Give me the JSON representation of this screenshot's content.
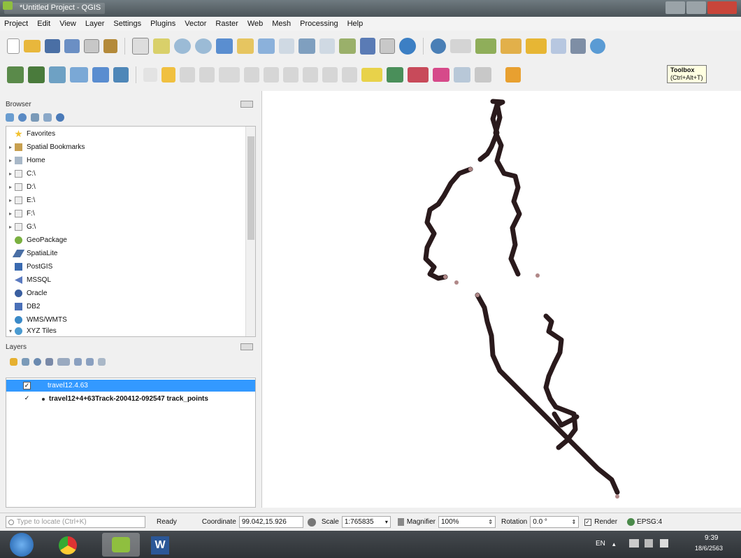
{
  "window": {
    "title": "*Untitled Project - QGIS"
  },
  "menu": [
    "Project",
    "Edit",
    "View",
    "Layer",
    "Settings",
    "Plugins",
    "Vector",
    "Raster",
    "Web",
    "Mesh",
    "Processing",
    "Help"
  ],
  "toolbar": {
    "tooltip_title": "Toolbox",
    "tooltip_shortcut": "(Ctrl+Alt+T)"
  },
  "browser": {
    "title": "Browser",
    "items": [
      {
        "label": "Favorites",
        "icon": "star-icon",
        "expandable": false
      },
      {
        "label": "Spatial Bookmarks",
        "icon": "bookmark-icon",
        "expandable": true
      },
      {
        "label": "Home",
        "icon": "home-folder-icon",
        "expandable": true
      },
      {
        "label": "C:\\",
        "icon": "drive-icon",
        "expandable": true
      },
      {
        "label": "D:\\",
        "icon": "drive-icon",
        "expandable": true
      },
      {
        "label": "E:\\",
        "icon": "drive-icon",
        "expandable": true
      },
      {
        "label": "F:\\",
        "icon": "drive-icon",
        "expandable": true
      },
      {
        "label": "G:\\",
        "icon": "drive-icon",
        "expandable": true
      },
      {
        "label": "GeoPackage",
        "icon": "geopackage-icon",
        "expandable": false
      },
      {
        "label": "SpatiaLite",
        "icon": "spatialite-icon",
        "expandable": false
      },
      {
        "label": "PostGIS",
        "icon": "postgis-icon",
        "expandable": false
      },
      {
        "label": "MSSQL",
        "icon": "mssql-icon",
        "expandable": false
      },
      {
        "label": "Oracle",
        "icon": "oracle-icon",
        "expandable": false
      },
      {
        "label": "DB2",
        "icon": "db2-icon",
        "expandable": false
      },
      {
        "label": "WMS/WMTS",
        "icon": "wms-icon",
        "expandable": false
      },
      {
        "label": "XYZ Tiles",
        "icon": "xyz-tiles-icon",
        "expandable": true
      }
    ]
  },
  "layers": {
    "title": "Layers",
    "items": [
      {
        "label": "travel12.4.63",
        "selected": true,
        "checked": true
      },
      {
        "label": "travel12+4+63Track-200412-092547 track_points",
        "selected": false,
        "checked": true
      }
    ]
  },
  "status": {
    "search_placeholder": "Type to locate (Ctrl+K)",
    "ready": "Ready",
    "coordinate_label": "Coordinate",
    "coordinate_value": "99.042,15.926",
    "scale_label": "Scale",
    "scale_value": "1:765835",
    "magnifier_label": "Magnifier",
    "magnifier_value": "100%",
    "rotation_label": "Rotation",
    "rotation_value": "0.0 °",
    "render_label": "Render",
    "crs_label": "EPSG:4"
  },
  "taskbar": {
    "language": "EN",
    "time": "9:39",
    "date": "18/6/2563"
  },
  "colors": {
    "track": "#2a1a1c",
    "selection": "#3399ff",
    "accent_green": "#8fbf3f"
  }
}
